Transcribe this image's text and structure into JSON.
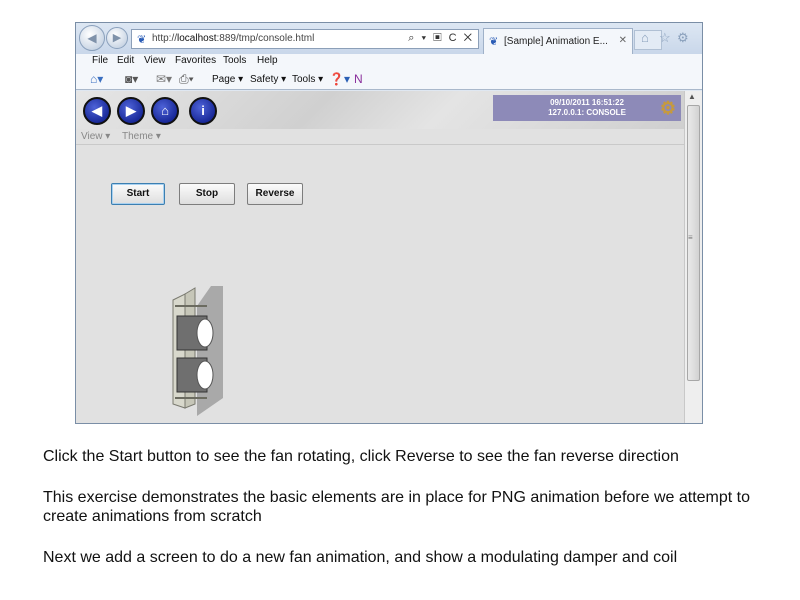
{
  "browser": {
    "address_url_prefix": "http://",
    "address_url_host": "localhost",
    "address_url_rest": ":889/tmp/console.html",
    "tab_title": "[Sample] Animation E...",
    "address_controls": "⌕ ▾ ▣ C ✕",
    "menu": [
      "File",
      "Edit",
      "View",
      "Favorites",
      "Tools",
      "Help"
    ],
    "commands": {
      "page": "Page ▾",
      "safety": "Safety ▾",
      "tools": "Tools ▾"
    }
  },
  "app": {
    "status_datetime": "09/10/2011 16:51:22",
    "status_host": "127.0.0.1: CONSOLE",
    "view_menu": "View ▾",
    "theme_menu": "Theme ▾",
    "buttons": {
      "start": "Start",
      "stop": "Stop",
      "reverse": "Reverse"
    }
  },
  "captions": {
    "line1": "Click the Start button to see the fan rotating, click Reverse to see the fan reverse direction",
    "line2": "This exercise demonstrates the basic elements are in place for PNG animation before we attempt to create animations from scratch",
    "line3": "Next we add a screen to do a new fan animation, and show a modulating damper and coil"
  },
  "colors": {
    "nav_button": "#1a2a9a",
    "status_box": "#8d8ab8",
    "page_background": "#e1e1e1"
  }
}
